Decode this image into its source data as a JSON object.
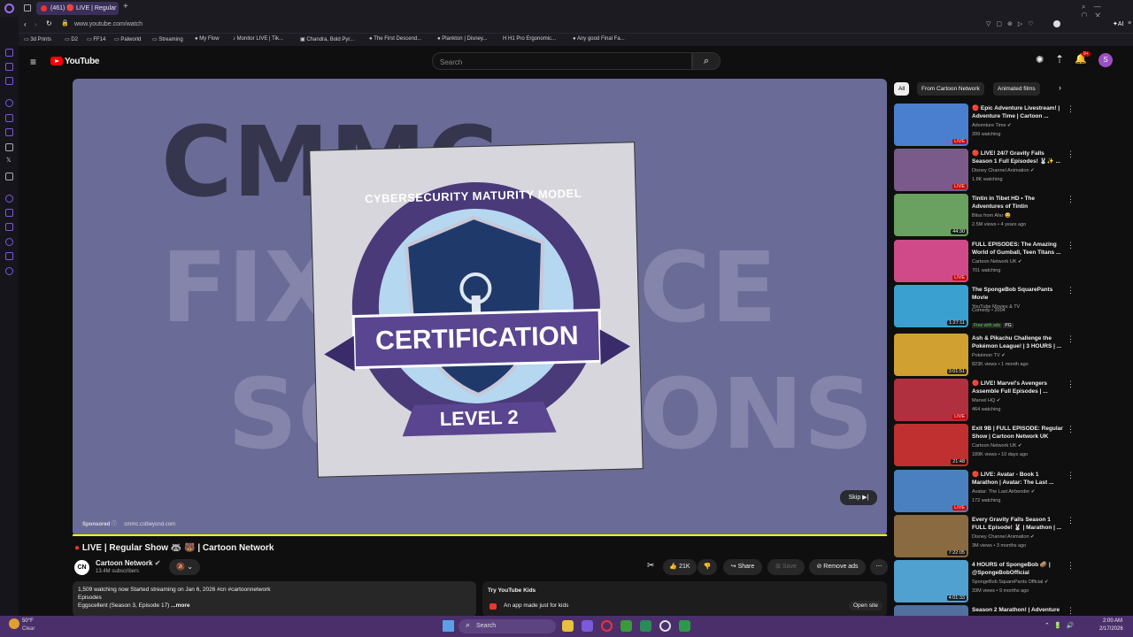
{
  "browser": {
    "tab_title": "(461) 🔴 LIVE | Regular",
    "url": "www.youtube.com/watch",
    "bookmarks": [
      "3d Prints",
      "D2",
      "FF14",
      "Palworld",
      "Streaming",
      "My Flow",
      "Monitor LIVE | Tik...",
      "Chandra, Bold Pyr...",
      "The First Descend...",
      "Plankton | Disney...",
      "H1 Pro Ergonomic...",
      "Any good Final Fa..."
    ],
    "ai_label": "AI"
  },
  "youtube": {
    "logo": "YouTube",
    "search_placeholder": "Search",
    "notif_count": "9+",
    "avatar_letter": "S"
  },
  "video": {
    "bg_text_1": "CMMC",
    "bg_text_2": "FIX",
    "bg_text_3": "CE",
    "bg_text_4": "SO",
    "bg_text_5": "ONS",
    "badge_top": "CYBERSECURITY MATURITY MODEL",
    "badge_main": "CERTIFICATION",
    "badge_level": "LEVEL 2",
    "sponsored": "Sponsored",
    "ad_url": "cmmc.cslbeyond.com",
    "skip": "Skip",
    "progress": 1.0
  },
  "info": {
    "title": "LIVE | Regular Show 🦝 🐻 | Cartoon Network",
    "channel_logo": "CN",
    "channel": "Cartoon Network",
    "subs": "13.4M subscribers",
    "likes": "21K",
    "share": "Share",
    "save": "Save",
    "remove_ads": "Remove ads",
    "desc_line1": "1,509 watching now  Started streaming on Jan 6, 2026  #cn #cartoonnetwork",
    "desc_line2": "Episodes",
    "desc_line3": "Eggscellent (Season 3, Episode 17)",
    "desc_more": "...more",
    "kids_title": "Try YouTube Kids",
    "kids_sub": "An app made just for kids",
    "kids_btn": "Open site"
  },
  "chips": [
    "All",
    "From Cartoon Network",
    "Animated films"
  ],
  "recs": [
    {
      "title": "🔴 Epic Adventure Livestream! | Adventure Time | Cartoon ...",
      "channel": "Adventure Time ✔",
      "meta": "399 watching",
      "badge": "LIVE",
      "color": "#4a7fd0"
    },
    {
      "title": "🔴 LIVE! 24/7 Gravity Falls Season 1 Full Episodes! 🐰✨ ...",
      "channel": "Disney Channel Animation ✔",
      "meta": "1.8K watching",
      "badge": "LIVE",
      "color": "#7a5a8a"
    },
    {
      "title": "Tintin in Tibet HD • The Adventures of Tintin",
      "channel": "Bliss from Afar 😀",
      "meta": "2.5M views • 4 years ago",
      "badge": "44:30",
      "color": "#6aa060"
    },
    {
      "title": "FULL EPISODES: The Amazing World of Gumball, Teen Titans ...",
      "channel": "Cartoon Network UK ✔",
      "meta": "701 watching",
      "badge": "LIVE",
      "color": "#d04a8a"
    },
    {
      "title": "The SpongeBob SquarePants Movie",
      "channel": "YouTube Movies & TV",
      "meta": "Comedy • 2004",
      "badge": "1:27:11",
      "color": "#3aa0d0"
    },
    {
      "title": "Ash & Pikachu Challenge the Pokémon League! | 3 HOURS | ...",
      "channel": "Pokémon TV ✔",
      "meta": "823K views • 1 month ago",
      "badge": "3:01:51",
      "color": "#d0a030"
    },
    {
      "title": "🔴 LIVE! Marvel's Avengers Assemble Full Episodes | ...",
      "channel": "Marvel HQ ✔",
      "meta": "464 watching",
      "badge": "LIVE",
      "color": "#b03040"
    },
    {
      "title": "Exit 9B | FULL EPISODE: Regular Show | Cartoon Network UK",
      "channel": "Cartoon Network UK ✔",
      "meta": "189K views • 10 days ago",
      "badge": "21:48",
      "color": "#c03030"
    },
    {
      "title": "🔴 LIVE: Avatar - Book 1 Marathon | Avatar: The Last ...",
      "channel": "Avatar: The Last Airbender ✔",
      "meta": "172 watching",
      "badge": "LIVE",
      "color": "#4a80c0"
    },
    {
      "title": "Every Gravity Falls Season 1 FULL Episode! 🐰 | Marathon | ...",
      "channel": "Disney Channel Animation ✔",
      "meta": "3M views • 3 months ago",
      "badge": "7:22:05",
      "color": "#8a6a40"
    },
    {
      "title": "4 HOURS of SpongeBob 🥔 | @SpongeBobOfficial",
      "channel": "SpongeBob SquarePants Official ✔",
      "meta": "33M views • 9 months ago",
      "badge": "4:01:33",
      "color": "#50a0d0"
    },
    {
      "title": "Season 2 Marathon! | Adventure",
      "channel": "",
      "meta": "",
      "badge": "",
      "color": "#5070a0"
    }
  ],
  "movie_tags": [
    "Free with ads",
    "PG"
  ],
  "taskbar": {
    "weather_temp": "50°F",
    "weather_text": "Clear",
    "search": "Search",
    "time": "2:00 AM",
    "date": "2/17/2026"
  }
}
